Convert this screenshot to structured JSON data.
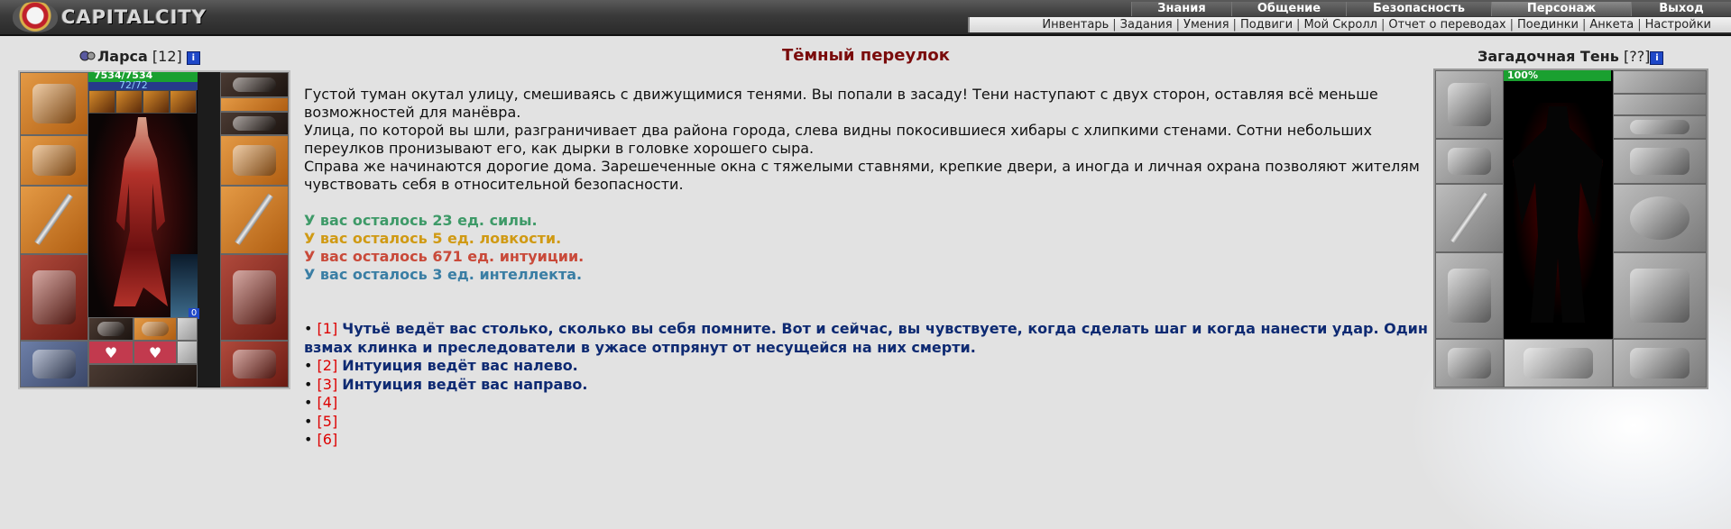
{
  "header": {
    "logo_text": "CAPITALCITY",
    "main_nav": [
      "Знания",
      "Общение",
      "Безопасность",
      "Персонаж",
      "Выход"
    ],
    "active_main": "Персонаж",
    "sub_nav": [
      "Инвентарь",
      "Задания",
      "Умения",
      "Подвиги",
      "Мой Скролл",
      "Отчет о переводах",
      "Поединки",
      "Анкета",
      "Настройки"
    ]
  },
  "player": {
    "name": "Ларса",
    "level": "[12]",
    "info_icon": "i",
    "hp": "7534/7534",
    "mp": "72/72",
    "pet_count": "0",
    "hearts": [
      "♥",
      "♥"
    ]
  },
  "location": {
    "title": "Тёмный переулок",
    "paragraphs": [
      "Густой туман окутал улицу, смешиваясь с движущимися тенями. Вы попали в засаду! Тени наступают с двух сторон, оставляя всё меньше возможностей для манёвра.",
      "Улица, по которой вы шли, разграничивает два района города, слева видны покосившиеся хибары с хлипкими стенами. Сотни небольших переулков пронизывают его, как дырки в головке хорошего сыра.",
      "Справа же начинаются дорогие дома. Зарешеченные окна с тяжелыми ставнями, крепкие двери, а иногда и личная охрана позволяют жителям чувствовать себя в относительной безопасности."
    ]
  },
  "stats": {
    "strength": "У вас осталось 23 ед. силы.",
    "agility": "У вас осталось 5 ед. ловкости.",
    "intuition": "У вас осталось 671 ед. интуиции.",
    "intellect": "У вас осталось 3 ед. интеллекта.",
    "colors": {
      "strength": "#3e9a68",
      "agility": "#d09a14",
      "intuition": "#c94a3a",
      "intellect": "#3a7ea4"
    }
  },
  "options": [
    {
      "bullet": "•",
      "num": "[1]",
      "text": "Чутьё ведёт вас столько, сколько вы себя помните. Вот и сейчас, вы чувствуете, когда сделать шаг и когда нанести удар. Один взмах клинка и преследователи в ужасе отпрянут от несущейся на них смерти."
    },
    {
      "bullet": "•",
      "num": "[2]",
      "text": "Интуиция ведёт вас налево."
    },
    {
      "bullet": "•",
      "num": "[3]",
      "text": "Интуиция ведёт вас направо."
    },
    {
      "bullet": "•",
      "num": "[4]",
      "text": ""
    },
    {
      "bullet": "•",
      "num": "[5]",
      "text": ""
    },
    {
      "bullet": "•",
      "num": "[6]",
      "text": ""
    }
  ],
  "enemy": {
    "name": "Загадочная Тень",
    "level": "[??]",
    "info_icon": "i",
    "hp": "100%"
  }
}
